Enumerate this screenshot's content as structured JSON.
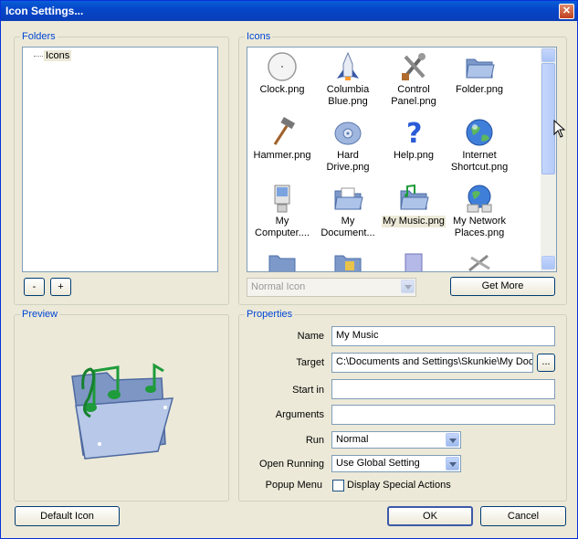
{
  "window": {
    "title": "Icon Settings...",
    "close_label": "✕"
  },
  "folders": {
    "group_label": "Folders",
    "tree_item": "Icons",
    "minus_label": "-",
    "plus_label": "+"
  },
  "icons": {
    "group_label": "Icons",
    "items": [
      {
        "label_line1": "Clock.png",
        "label_line2": "",
        "icon": "clock-icon"
      },
      {
        "label_line1": "Columbia",
        "label_line2": "Blue.png",
        "icon": "shuttle-icon"
      },
      {
        "label_line1": "Control",
        "label_line2": "Panel.png",
        "icon": "tools-icon"
      },
      {
        "label_line1": "Folder.png",
        "label_line2": "",
        "icon": "folder-icon"
      },
      {
        "label_line1": "Hammer.png",
        "label_line2": "",
        "icon": "hammer-icon"
      },
      {
        "label_line1": "Hard",
        "label_line2": "Drive.png",
        "icon": "hard-drive-icon"
      },
      {
        "label_line1": "Help.png",
        "label_line2": "",
        "icon": "help-icon"
      },
      {
        "label_line1": "Internet",
        "label_line2": "Shortcut.png",
        "icon": "globe-icon"
      },
      {
        "label_line1": "My",
        "label_line2": "Computer....",
        "icon": "computer-icon"
      },
      {
        "label_line1": "My",
        "label_line2": "Document...",
        "icon": "documents-folder-icon"
      },
      {
        "label_line1": "My Music.png",
        "label_line2": "",
        "icon": "music-folder-icon"
      },
      {
        "label_line1": "My Network",
        "label_line2": "Places.png",
        "icon": "network-globe-icon"
      }
    ],
    "mode_select": "Normal Icon",
    "get_more_label": "Get More"
  },
  "preview": {
    "group_label": "Preview",
    "icon": "music-folder-large-icon"
  },
  "properties": {
    "group_label": "Properties",
    "name_label": "Name",
    "name_value": "My Music",
    "target_label": "Target",
    "target_value": "C:\\Documents and Settings\\Skunkie\\My Doc",
    "browse_label": "...",
    "start_in_label": "Start in",
    "start_in_value": "",
    "arguments_label": "Arguments",
    "arguments_value": "",
    "run_label": "Run",
    "run_value": "Normal",
    "open_running_label": "Open Running",
    "open_running_value": "Use Global Setting",
    "popup_menu_label": "Popup Menu",
    "popup_checkbox_label": "Display Special Actions"
  },
  "footer": {
    "default_icon_label": "Default Icon",
    "ok_label": "OK",
    "cancel_label": "Cancel"
  }
}
